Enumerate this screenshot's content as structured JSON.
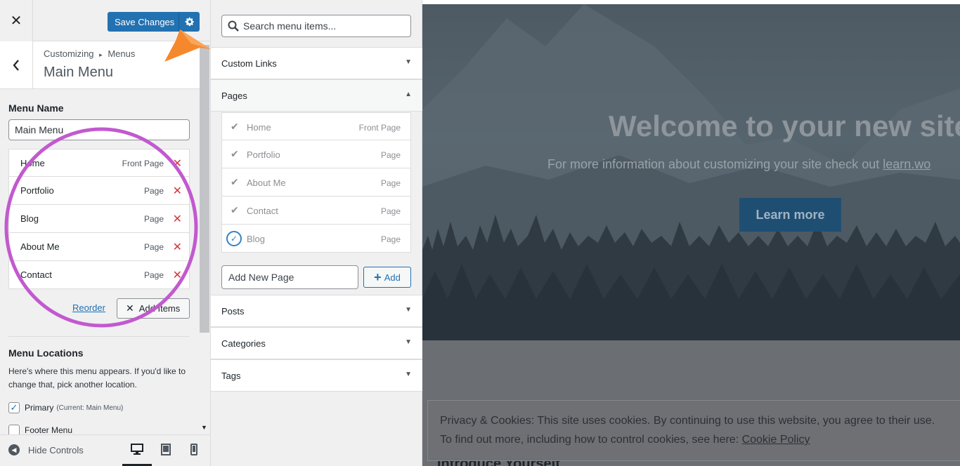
{
  "topbar": {
    "close_icon": "close-icon",
    "save_label": "Save Changes",
    "settings_icon": "gear-icon",
    "accent": "#2271b1",
    "annotation_arrow_color": "#f5882d"
  },
  "section": {
    "breadcrumb_parent": "Customizing",
    "breadcrumb_separator": "▸",
    "breadcrumb_child": "Menus",
    "title": "Main Menu"
  },
  "menu": {
    "name_label": "Menu Name",
    "name_value": "Main Menu",
    "items": [
      {
        "title": "Home",
        "type": "Front Page"
      },
      {
        "title": "Portfolio",
        "type": "Page"
      },
      {
        "title": "Blog",
        "type": "Page"
      },
      {
        "title": "About Me",
        "type": "Page"
      },
      {
        "title": "Contact",
        "type": "Page"
      }
    ],
    "remove_glyph": "✕",
    "reorder_label": "Reorder",
    "add_items_label": "Add Items",
    "annotation_circle_color": "#c259cf"
  },
  "locations": {
    "title": "Menu Locations",
    "description": "Here's where this menu appears. If you'd like to change that, pick another location.",
    "items": [
      {
        "label": "Primary",
        "current": "(Current: Main Menu)",
        "checked": true
      },
      {
        "label": "Footer Menu",
        "current": "",
        "checked": false
      }
    ]
  },
  "footer": {
    "hide_controls_label": "Hide Controls",
    "devices": [
      "desktop-icon",
      "tablet-icon",
      "mobile-icon"
    ],
    "active_device": "desktop"
  },
  "available": {
    "search_placeholder": "Search menu items...",
    "sections": {
      "custom_links": "Custom Links",
      "pages": "Pages",
      "posts": "Posts",
      "categories": "Categories",
      "tags": "Tags"
    },
    "pages": [
      {
        "title": "Home",
        "type": "Front Page",
        "state": "added"
      },
      {
        "title": "Portfolio",
        "type": "Page",
        "state": "added"
      },
      {
        "title": "About Me",
        "type": "Page",
        "state": "added"
      },
      {
        "title": "Contact",
        "type": "Page",
        "state": "added"
      },
      {
        "title": "Blog",
        "type": "Page",
        "state": "just-added"
      }
    ],
    "new_page_placeholder": "Add New Page",
    "add_label": "Add"
  },
  "preview": {
    "hero_title": "Welcome to your new site",
    "hero_sub": "For more information about customizing your site check out",
    "hero_link": "learn.wo",
    "learn_button": "Learn more",
    "cookie_line1": "Privacy & Cookies: This site uses cookies. By continuing to use this website, you agree to their use.",
    "cookie_line2": "To find out more, including how to control cookies, see here:",
    "cookie_link": "Cookie Policy",
    "intro_heading": "Introduce Yourself"
  }
}
